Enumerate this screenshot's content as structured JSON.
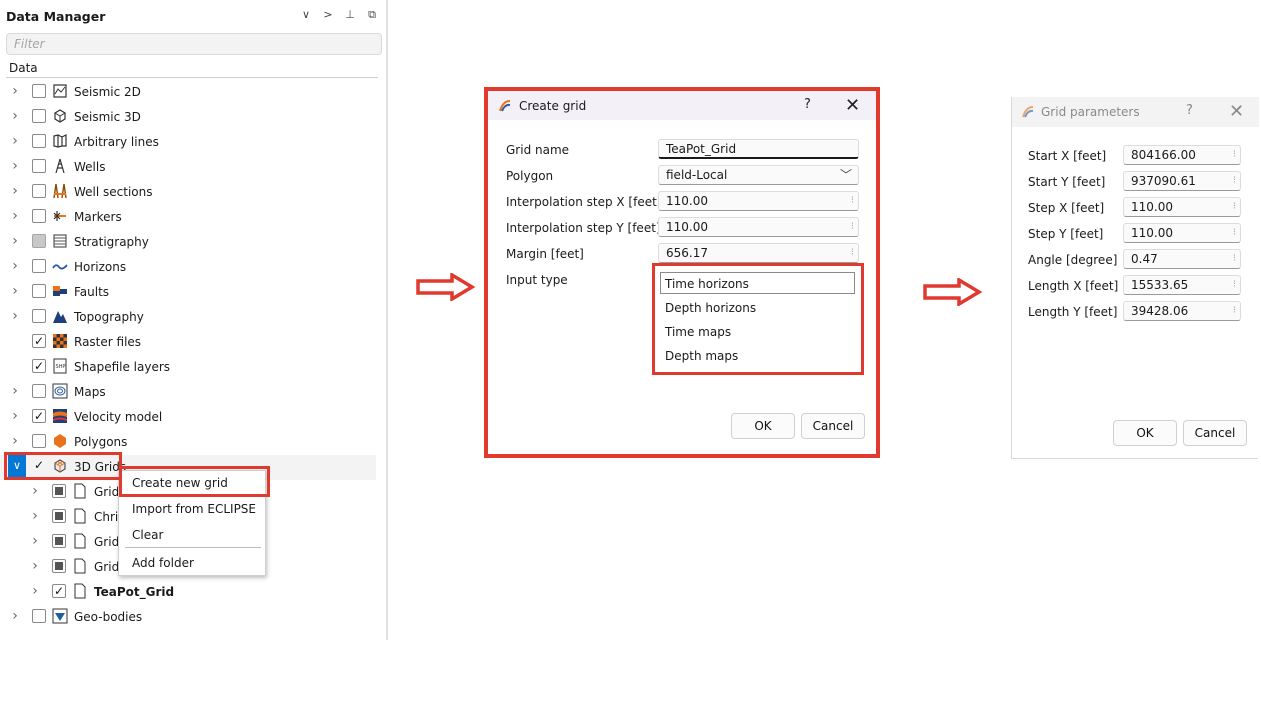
{
  "data_manager": {
    "title": "Data Manager",
    "controls": {
      "collapse": "∨",
      "expand": ">",
      "pin": "⊥",
      "float": "⧉"
    },
    "filter_placeholder": "Filter",
    "column_header": "Data",
    "tree": [
      {
        "label": "Seismic 2D",
        "icon": "seismic-2d-icon",
        "check": "unchecked"
      },
      {
        "label": "Seismic 3D",
        "icon": "seismic-3d-icon",
        "check": "unchecked"
      },
      {
        "label": "Arbitrary lines",
        "icon": "arbitrary-lines-icon",
        "check": "unchecked"
      },
      {
        "label": "Wells",
        "icon": "well-icon",
        "check": "unchecked"
      },
      {
        "label": "Well sections",
        "icon": "well-sections-icon",
        "check": "unchecked"
      },
      {
        "label": "Markers",
        "icon": "markers-icon",
        "check": "unchecked"
      },
      {
        "label": "Stratigraphy",
        "icon": "stratigraphy-icon",
        "check": "partial"
      },
      {
        "label": "Horizons",
        "icon": "horizons-icon",
        "check": "unchecked"
      },
      {
        "label": "Faults",
        "icon": "faults-icon",
        "check": "unchecked"
      },
      {
        "label": "Topography",
        "icon": "topography-icon",
        "check": "unchecked"
      },
      {
        "label": "Raster files",
        "icon": "raster-icon",
        "check": "checked"
      },
      {
        "label": "Shapefile layers",
        "icon": "shapefile-icon",
        "check": "checked"
      },
      {
        "label": "Maps",
        "icon": "maps-icon",
        "check": "unchecked"
      },
      {
        "label": "Velocity model",
        "icon": "velocity-model-icon",
        "check": "checked"
      },
      {
        "label": "Polygons",
        "icon": "polygons-icon",
        "check": "unchecked"
      },
      {
        "label": "3D Grids",
        "icon": "grid-3d-icon",
        "check": "checked"
      },
      {
        "label": "Grid",
        "icon": "grid-file-icon",
        "check": "square"
      },
      {
        "label": "Chri",
        "icon": "grid-file-icon",
        "check": "square"
      },
      {
        "label": "Grid",
        "icon": "grid-file-icon",
        "check": "square"
      },
      {
        "label": "Grid",
        "icon": "grid-file-icon",
        "check": "square"
      },
      {
        "label": "TeaPot_Grid",
        "icon": "grid-file-icon",
        "check": "checked"
      },
      {
        "label": "Geo-bodies",
        "icon": "geo-bodies-icon",
        "check": "unchecked"
      }
    ],
    "context_menu": [
      "Create new grid",
      "Import from ECLIPSE",
      "Clear",
      "Add folder"
    ]
  },
  "create_grid": {
    "title": "Create grid",
    "help": "?",
    "close": "✕",
    "fields": {
      "grid_name": {
        "label": "Grid name",
        "value": "TeaPot_Grid"
      },
      "polygon": {
        "label": "Polygon",
        "value": "field-Local"
      },
      "step_x": {
        "label": "Interpolation step X [feet]",
        "value": "110.00"
      },
      "step_y": {
        "label": "Interpolation step Y [feet]",
        "value": "110.00"
      },
      "margin": {
        "label": "Margin [feet]",
        "value": "656.17"
      },
      "input_type_label": "Input type"
    },
    "input_types": [
      "Time horizons",
      "Depth horizons",
      "Time maps",
      "Depth maps"
    ],
    "ok": "OK",
    "cancel": "Cancel"
  },
  "grid_parameters": {
    "title": "Grid parameters",
    "help": "?",
    "close": "✕",
    "fields": [
      {
        "label": "Start X [feet]",
        "value": "804166.00"
      },
      {
        "label": "Start Y [feet]",
        "value": "937090.61"
      },
      {
        "label": "Step X [feet]",
        "value": "110.00"
      },
      {
        "label": "Step Y [feet]",
        "value": "110.00"
      },
      {
        "label": "Angle [degree]",
        "value": "0.47"
      },
      {
        "label": "Length X [feet]",
        "value": "15533.65"
      },
      {
        "label": "Length Y [feet]",
        "value": "39428.06"
      }
    ],
    "ok": "OK",
    "cancel": "Cancel"
  },
  "colors": {
    "highlight": "#e0392e",
    "selection": "#0078d4"
  }
}
